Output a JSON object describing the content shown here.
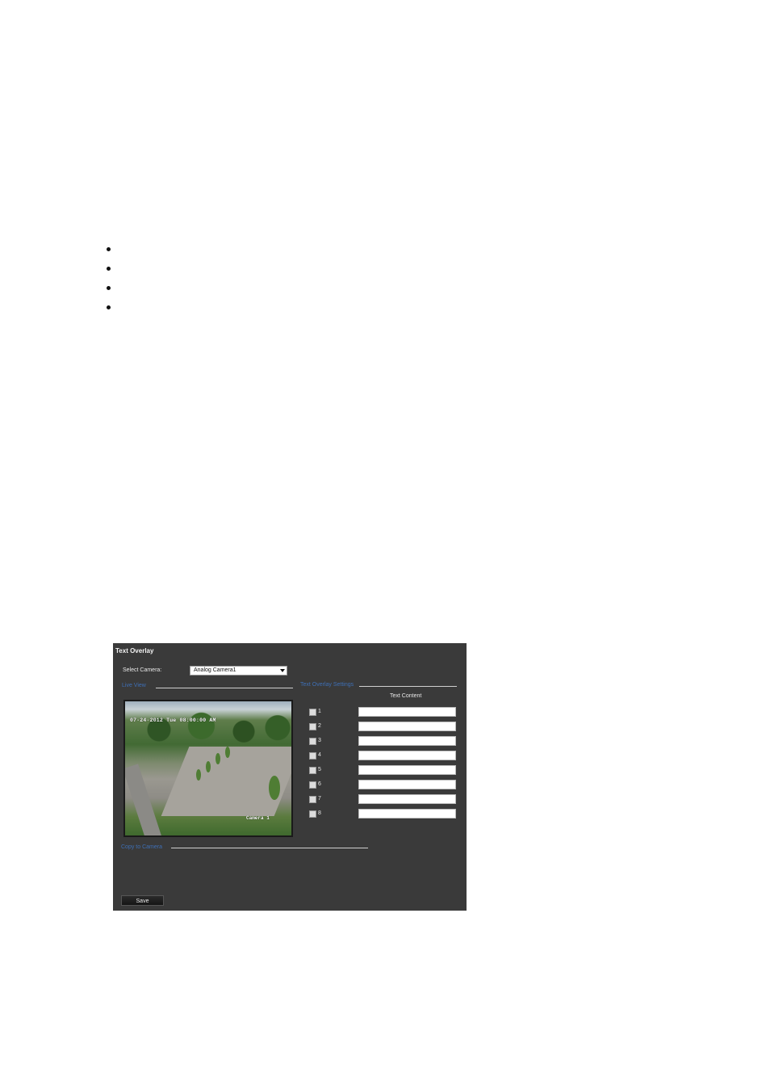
{
  "panel": {
    "title": "Text Overlay",
    "select_camera_label": "Select Camera:",
    "select_camera_value": "Analog Camera1",
    "live_view_label": "Live View",
    "text_overlay_settings_label": "Text Overlay Settings",
    "text_content_header": "Text Content",
    "copy_to_camera_label": "Copy to Camera",
    "save_label": "Save",
    "live_view_timestamp": "07-24-2012 Tue 08:00:00 AM",
    "live_view_camera_name": "Camera 1",
    "overlay_rows": [
      {
        "number": "1",
        "checked": false,
        "text": ""
      },
      {
        "number": "2",
        "checked": false,
        "text": ""
      },
      {
        "number": "3",
        "checked": false,
        "text": ""
      },
      {
        "number": "4",
        "checked": false,
        "text": ""
      },
      {
        "number": "5",
        "checked": false,
        "text": ""
      },
      {
        "number": "6",
        "checked": false,
        "text": ""
      },
      {
        "number": "7",
        "checked": false,
        "text": ""
      },
      {
        "number": "8",
        "checked": false,
        "text": ""
      }
    ]
  },
  "colors": {
    "panel_background": "#3a3a3a",
    "section_label": "#3e6fb5"
  }
}
